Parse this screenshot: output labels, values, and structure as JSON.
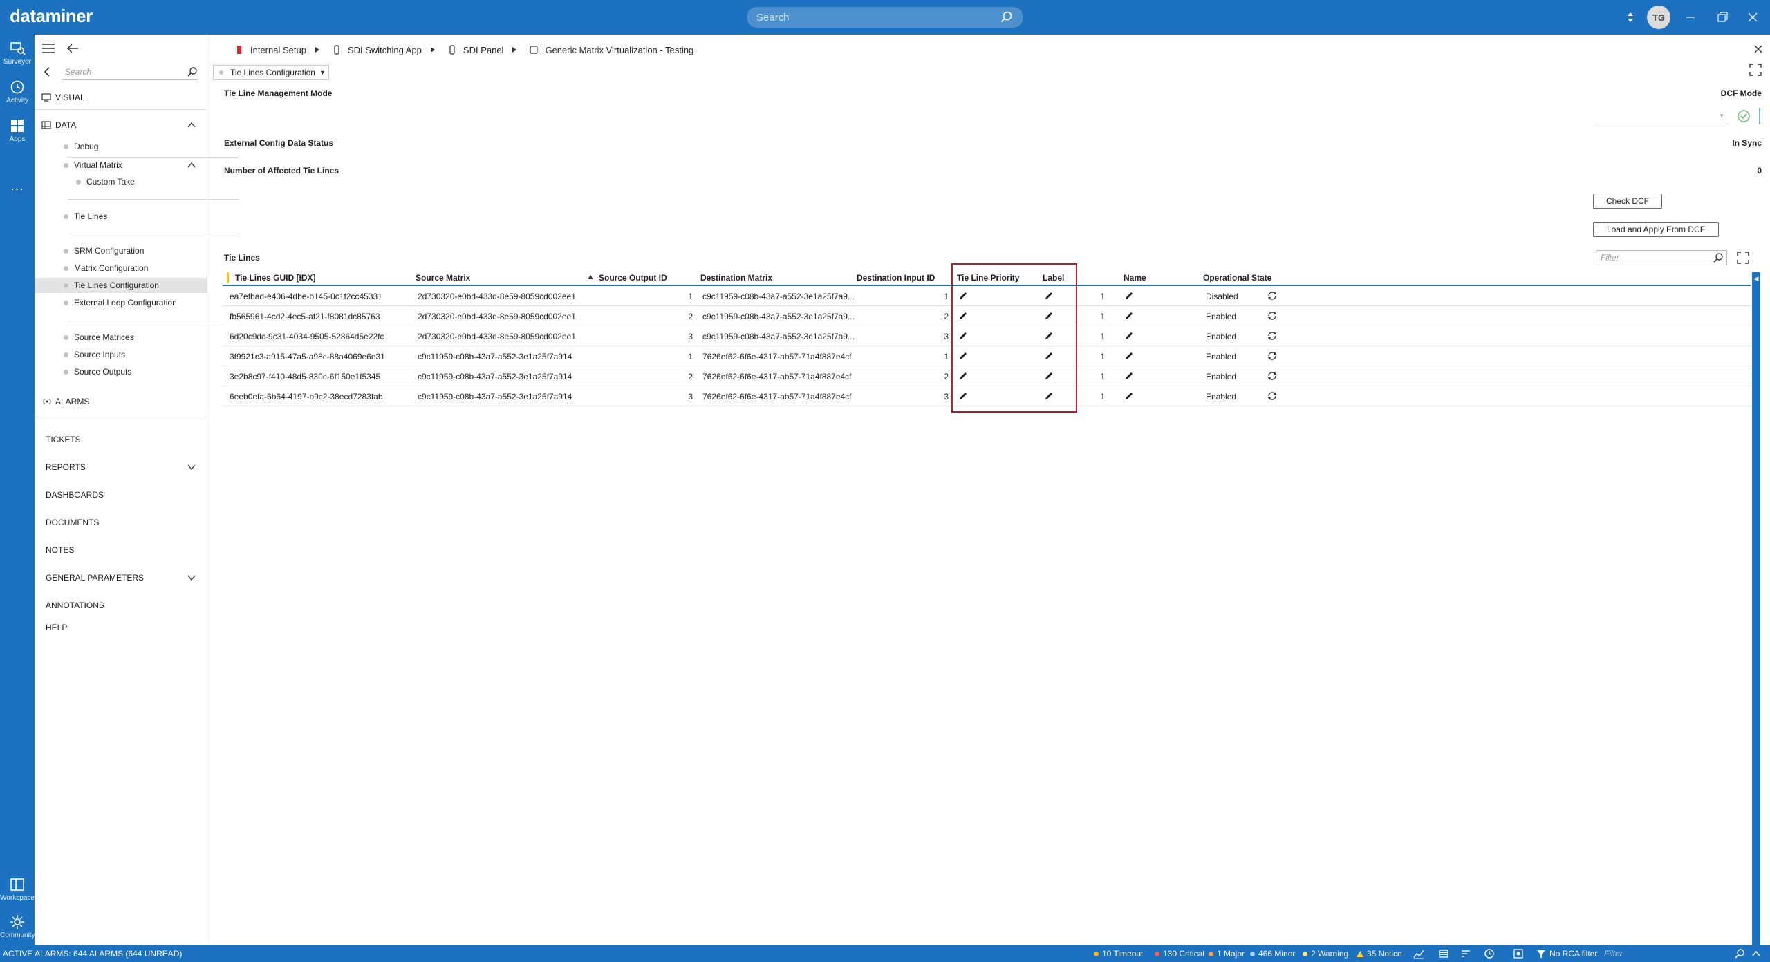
{
  "app": {
    "logo": "dataminer",
    "search_placeholder": "Search",
    "user_initials": "TG"
  },
  "rail": {
    "surveyor": "Surveyor",
    "activity": "Activity",
    "apps": "Apps",
    "more": "...",
    "workspace": "Workspace",
    "community": "Community"
  },
  "sidebar": {
    "search_placeholder": "Search",
    "visual": "VISUAL",
    "data": "DATA",
    "items": {
      "debug": "Debug",
      "virtual_matrix": "Virtual Matrix",
      "custom_take": "Custom Take",
      "tie_lines": "Tie Lines",
      "srm_configuration": "SRM Configuration",
      "matrix_configuration": "Matrix Configuration",
      "tie_lines_configuration": "Tie Lines Configuration",
      "external_loop_configuration": "External Loop Configuration",
      "source_matrices": "Source Matrices",
      "source_inputs": "Source Inputs",
      "source_outputs": "Source Outputs"
    },
    "alarms": "ALARMS",
    "tickets": "TICKETS",
    "reports": "REPORTS",
    "dashboards": "DASHBOARDS",
    "documents": "DOCUMENTS",
    "notes": "NOTES",
    "general_parameters": "GENERAL PARAMETERS",
    "annotations": "ANNOTATIONS",
    "help": "HELP"
  },
  "breadcrumb": {
    "internal_setup": "Internal Setup",
    "sdi_switching_app": "SDI Switching App",
    "sdi_panel": "SDI Panel",
    "generic_matrix": "Generic Matrix Virtualization - Testing"
  },
  "page_selector": "Tie Lines Configuration",
  "fields": {
    "mode_label": "Tie Line Management Mode",
    "mode_value": "DCF Mode",
    "status_label": "External Config Data Status",
    "status_value": "In Sync",
    "affected_label": "Number of Affected Tie Lines",
    "affected_value": "0"
  },
  "buttons": {
    "check_dcf": "Check DCF",
    "load_apply_dcf": "Load and Apply From DCF"
  },
  "table": {
    "heading": "Tie Lines",
    "filter_placeholder": "Filter",
    "columns": {
      "guid": "Tie Lines GUID [IDX]",
      "source_matrix": "Source Matrix",
      "source_output": "Source Output ID",
      "dest_matrix": "Destination Matrix",
      "dest_input": "Destination Input ID",
      "priority": "Tie Line Priority",
      "label": "Label",
      "name": "Name",
      "op_state": "Operational State"
    },
    "rows": [
      {
        "guid": "ea7efbad-e406-4dbe-b145-0c1f2cc45331",
        "source_matrix": "2d730320-e0bd-433d-8e59-8059cd002ee1",
        "source_output": "1",
        "dest_matrix": "c9c11959-c08b-43a7-a552-3e1a25f7a9...",
        "dest_input": "1",
        "priority": "1",
        "state": "Disabled"
      },
      {
        "guid": "fb565961-4cd2-4ec5-af21-f8081dc85763",
        "source_matrix": "2d730320-e0bd-433d-8e59-8059cd002ee1",
        "source_output": "2",
        "dest_matrix": "c9c11959-c08b-43a7-a552-3e1a25f7a9...",
        "dest_input": "2",
        "priority": "1",
        "state": "Enabled"
      },
      {
        "guid": "6d20c9dc-9c31-4034-9505-52864d5e22fc",
        "source_matrix": "2d730320-e0bd-433d-8e59-8059cd002ee1",
        "source_output": "3",
        "dest_matrix": "c9c11959-c08b-43a7-a552-3e1a25f7a9...",
        "dest_input": "3",
        "priority": "1",
        "state": "Enabled"
      },
      {
        "guid": "3f9921c3-a915-47a5-a98c-88a4069e6e31",
        "source_matrix": "c9c11959-c08b-43a7-a552-3e1a25f7a914",
        "source_output": "1",
        "dest_matrix": "7626ef62-6f6e-4317-ab57-71a4f887e4cf",
        "dest_input": "1",
        "priority": "1",
        "state": "Enabled"
      },
      {
        "guid": "3e2b8c97-f410-48d5-830c-6f150e1f5345",
        "source_matrix": "c9c11959-c08b-43a7-a552-3e1a25f7a914",
        "source_output": "2",
        "dest_matrix": "7626ef62-6f6e-4317-ab57-71a4f887e4cf",
        "dest_input": "2",
        "priority": "1",
        "state": "Enabled"
      },
      {
        "guid": "6eeb0efa-6b64-4197-b9c2-38ecd7283fab",
        "source_matrix": "c9c11959-c08b-43a7-a552-3e1a25f7a914",
        "source_output": "3",
        "dest_matrix": "7626ef62-6f6e-4317-ab57-71a4f887e4cf",
        "dest_input": "3",
        "priority": "1",
        "state": "Enabled"
      }
    ]
  },
  "statusbar": {
    "active_alarms": "ACTIVE ALARMS: 644 ALARMS (644 UNREAD)",
    "timeout": "10 Timeout",
    "critical": "130 Critical",
    "major": "1 Major",
    "minor": "466 Minor",
    "warning": "2 Warning",
    "notice": "35 Notice",
    "rca": "No RCA filter",
    "filter_placeholder": "Filter"
  },
  "colors": {
    "brand": "#1c71c0",
    "timeout": "#ffb400",
    "critical": "#ff5a4a",
    "major": "#ff9a3c",
    "minor": "#9fd0ff",
    "warning": "#ffe070",
    "highlight": "#b61e2a"
  }
}
